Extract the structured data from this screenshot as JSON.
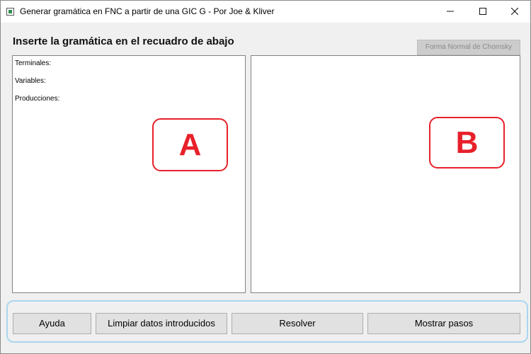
{
  "window": {
    "title": "Generar gramática en FNC a partir de una GIC G - Por Joe & Kliver",
    "minimize_icon": "minimize-icon",
    "maximize_icon": "maximize-icon",
    "close_icon": "close-icon"
  },
  "header": {
    "heading": "Inserte la gramática en el recuadro de abajo",
    "cnf_button": "Forma Normal de Chomsky"
  },
  "input_panel": {
    "lines": [
      "Terminales:",
      "Variables:",
      "Producciones:"
    ],
    "marker": "A"
  },
  "output_panel": {
    "marker": "B"
  },
  "actions": {
    "help": "Ayuda",
    "clear": "Limpiar datos introducidos",
    "solve": "Resolver",
    "steps": "Mostrar pasos"
  },
  "colors": {
    "marker": "#e8202a",
    "button_area_border": "#a9d6ef",
    "disabled_button_bg": "#cccccc"
  }
}
